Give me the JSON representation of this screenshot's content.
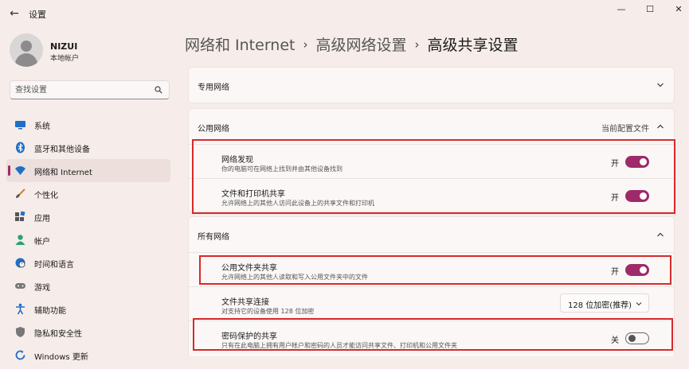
{
  "window": {
    "title": "设置",
    "back_glyph": "←",
    "minimize_glyph": "—",
    "maximize_glyph": "☐",
    "close_glyph": "✕"
  },
  "user": {
    "name": "NIZUI",
    "account_type": "本地帐户"
  },
  "search": {
    "placeholder": "查找设置",
    "icon": "search-icon"
  },
  "sidebar": {
    "items": [
      {
        "label": "系统",
        "icon": "system-icon"
      },
      {
        "label": "蓝牙和其他设备",
        "icon": "bluetooth-icon"
      },
      {
        "label": "网络和 Internet",
        "icon": "network-icon",
        "selected": true
      },
      {
        "label": "个性化",
        "icon": "brush-icon"
      },
      {
        "label": "应用",
        "icon": "apps-icon"
      },
      {
        "label": "帐户",
        "icon": "account-icon"
      },
      {
        "label": "时间和语言",
        "icon": "globe-clock-icon"
      },
      {
        "label": "游戏",
        "icon": "gamepad-icon"
      },
      {
        "label": "辅助功能",
        "icon": "accessibility-icon"
      },
      {
        "label": "隐私和安全性",
        "icon": "shield-icon"
      },
      {
        "label": "Windows 更新",
        "icon": "update-icon"
      }
    ]
  },
  "breadcrumb": {
    "items": [
      "网络和 Internet",
      "高级网络设置",
      "高级共享设置"
    ],
    "separator": "›"
  },
  "sections": {
    "private": {
      "title": "专用网络",
      "expanded": false
    },
    "public": {
      "title": "公用网络",
      "note": "当前配置文件",
      "expanded": true,
      "rows": [
        {
          "title": "网络发现",
          "desc": "你的电脑可在网络上找到并由其他设备找到",
          "state": "开",
          "on": true
        },
        {
          "title": "文件和打印机共享",
          "desc": "允许网络上的其他人访问此设备上的共享文件和打印机",
          "state": "开",
          "on": true
        }
      ]
    },
    "all": {
      "title": "所有网络",
      "expanded": true,
      "rows": [
        {
          "title": "公用文件夹共享",
          "desc": "允许网络上的其他人读取和写入公用文件夹中的文件",
          "state": "开",
          "on": true
        },
        {
          "title": "文件共享连接",
          "desc": "对支持它的设备使用 128 位加密",
          "dropdown": "128 位加密(推荐)"
        },
        {
          "title": "密码保护的共享",
          "desc": "只有在此电脑上拥有用户帐户和密码的人员才能访问共享文件、打印机和公用文件夹",
          "state": "关",
          "on": false
        }
      ]
    }
  },
  "colors": {
    "accent": "#9e2a6a",
    "background": "#f6ece9",
    "card": "#fbf7f6",
    "highlight": "#d62a2a"
  }
}
